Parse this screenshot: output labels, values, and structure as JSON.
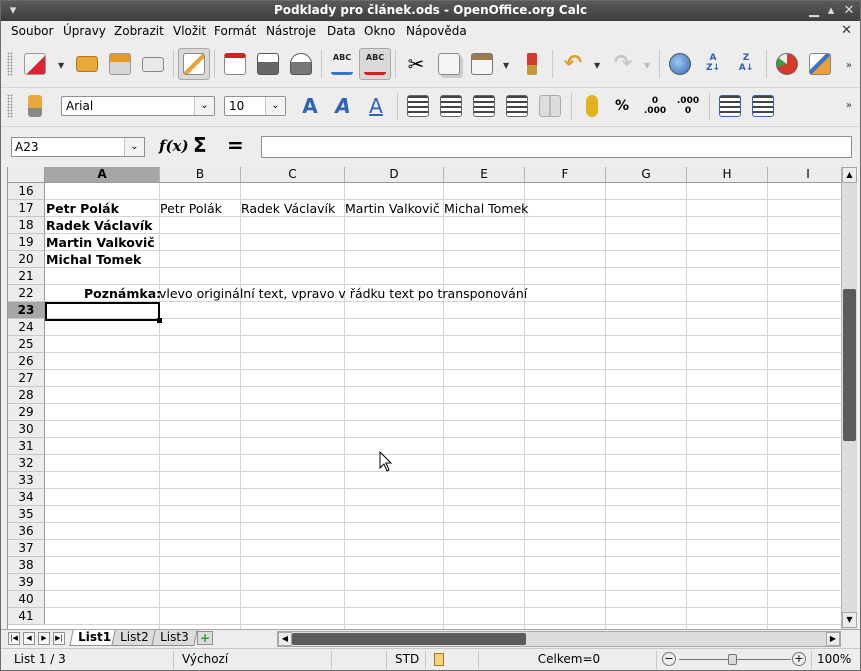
{
  "window": {
    "title": "Podklady pro článek.ods - OpenOffice.org Calc"
  },
  "menu": [
    "Soubor",
    "Úpravy",
    "Zobrazit",
    "Vložit",
    "Formát",
    "Nástroje",
    "Data",
    "Okno",
    "Nápověda"
  ],
  "formatting": {
    "font_name": "Arial",
    "font_size": "10"
  },
  "formula_bar": {
    "name_box": "A23",
    "content": ""
  },
  "columns": [
    "A",
    "B",
    "C",
    "D",
    "E",
    "F",
    "G",
    "H",
    "I"
  ],
  "rows": [
    "16",
    "17",
    "18",
    "19",
    "20",
    "21",
    "22",
    "23",
    "24",
    "25",
    "26",
    "27",
    "28",
    "29",
    "30",
    "31",
    "32",
    "33",
    "34",
    "35",
    "36",
    "37",
    "38",
    "39",
    "40",
    "41"
  ],
  "selected": {
    "column": "A",
    "row": "23"
  },
  "cells": {
    "a17": "Petr Polák",
    "a18": "Radek Václavík",
    "a19": "Martin Valkovič",
    "a20": "Michal Tomek",
    "b17": "Petr Polák",
    "c17": "Radek Václavík",
    "d17": "Martin Valkovič",
    "e17": "Michal Tomek",
    "note_label": "Poznámka:",
    "note_text": "vlevo originální text, vpravo v řádku text po transponování"
  },
  "sheets": [
    "List1",
    "List2",
    "List3"
  ],
  "active_sheet": "List1",
  "status": {
    "sheet_pos": "List 1 / 3",
    "page_style": "Výchozí",
    "mode": "STD",
    "sum": "Celkem=0",
    "zoom": "100%"
  },
  "colors": {
    "selected_header": "#a6a6a6",
    "title_bar": "#444444",
    "scroll_thumb": "#5b5b5b"
  }
}
